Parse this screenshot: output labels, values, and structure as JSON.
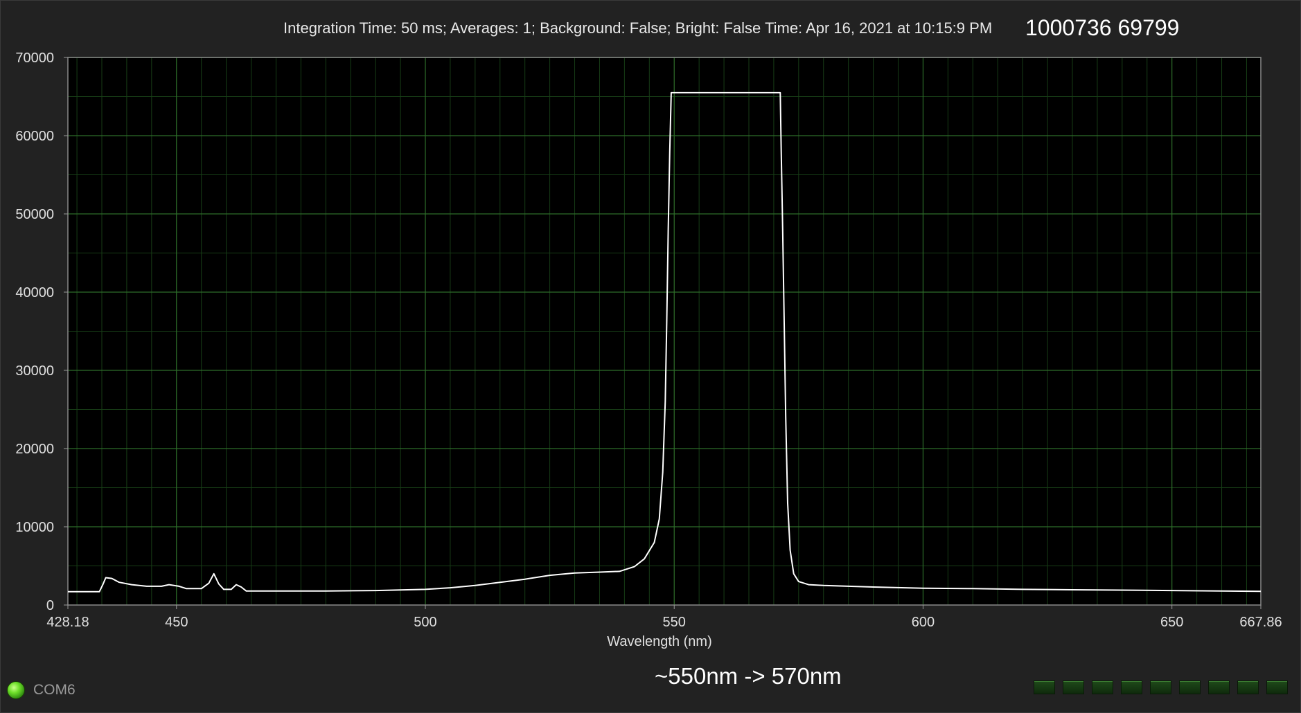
{
  "header": {
    "info": "Integration Time: 50 ms; Averages: 1; Background: False; Bright: False Time: Apr 16, 2021 at 10:15:9 PM",
    "serial": "1000736 69799"
  },
  "status": {
    "port_label": "COM6",
    "indicator_count": 9
  },
  "annotation": "~550nm -> 570nm",
  "colors": {
    "background": "#222222",
    "plot_bg": "#000000",
    "grid": "#2e6e2a",
    "line": "#ffffff",
    "led": "#6ee02a"
  },
  "chart_data": {
    "type": "line",
    "xlabel": "Wavelength (nm)",
    "ylabel": "",
    "xlim": [
      428.18,
      667.86
    ],
    "ylim": [
      0,
      70000
    ],
    "x_ticks": [
      428.18,
      450,
      500,
      550,
      600,
      650,
      667.86
    ],
    "x_tick_labels": [
      "428.18",
      "450",
      "500",
      "550",
      "600",
      "650",
      "667.86"
    ],
    "y_ticks": [
      0,
      10000,
      20000,
      30000,
      40000,
      50000,
      60000,
      70000
    ],
    "y_tick_labels": [
      "0",
      "10000",
      "20000",
      "30000",
      "40000",
      "50000",
      "60000",
      "70000"
    ],
    "grid": true,
    "series": [
      {
        "points": [
          [
            428.18,
            1700
          ],
          [
            434.5,
            1700
          ],
          [
            435.2,
            2600
          ],
          [
            435.8,
            3500
          ],
          [
            437,
            3400
          ],
          [
            438.5,
            2900
          ],
          [
            441,
            2600
          ],
          [
            444,
            2400
          ],
          [
            447,
            2400
          ],
          [
            448.5,
            2600
          ],
          [
            450.5,
            2400
          ],
          [
            452,
            2100
          ],
          [
            455,
            2100
          ],
          [
            456.5,
            2800
          ],
          [
            457.5,
            4000
          ],
          [
            458.5,
            2700
          ],
          [
            459.5,
            2000
          ],
          [
            461,
            2000
          ],
          [
            462,
            2600
          ],
          [
            463,
            2300
          ],
          [
            464,
            1800
          ],
          [
            470,
            1800
          ],
          [
            480,
            1800
          ],
          [
            490,
            1850
          ],
          [
            500,
            2000
          ],
          [
            505,
            2200
          ],
          [
            510,
            2500
          ],
          [
            515,
            2900
          ],
          [
            520,
            3300
          ],
          [
            525,
            3800
          ],
          [
            530,
            4100
          ],
          [
            535,
            4200
          ],
          [
            539,
            4300
          ],
          [
            542,
            4900
          ],
          [
            544,
            5900
          ],
          [
            546,
            8000
          ],
          [
            547,
            11000
          ],
          [
            547.7,
            17000
          ],
          [
            548.2,
            26000
          ],
          [
            548.5,
            36000
          ],
          [
            548.8,
            48000
          ],
          [
            549.1,
            58000
          ],
          [
            549.4,
            65500
          ],
          [
            571.3,
            65500
          ],
          [
            571.5,
            58000
          ],
          [
            571.8,
            48000
          ],
          [
            572.1,
            36000
          ],
          [
            572.4,
            24000
          ],
          [
            572.8,
            13000
          ],
          [
            573.3,
            7000
          ],
          [
            574,
            4000
          ],
          [
            575,
            3000
          ],
          [
            577,
            2600
          ],
          [
            580,
            2500
          ],
          [
            590,
            2300
          ],
          [
            600,
            2150
          ],
          [
            610,
            2100
          ],
          [
            620,
            2000
          ],
          [
            630,
            1950
          ],
          [
            640,
            1900
          ],
          [
            650,
            1850
          ],
          [
            660,
            1800
          ],
          [
            667.86,
            1750
          ]
        ]
      }
    ]
  }
}
